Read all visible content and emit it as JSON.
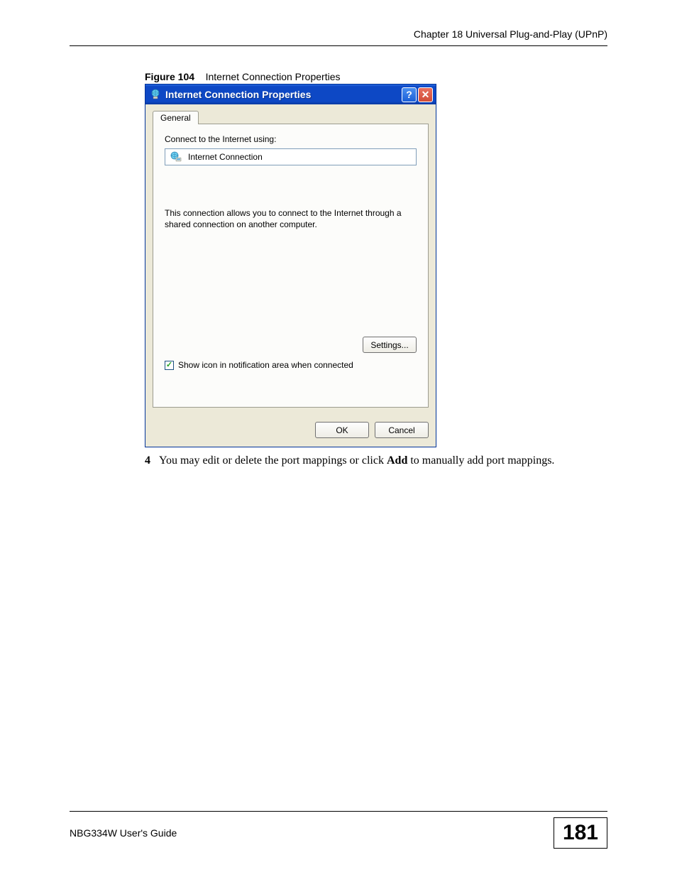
{
  "header": {
    "chapter": "Chapter 18 Universal Plug-and-Play (UPnP)"
  },
  "figure": {
    "label": "Figure 104",
    "caption": "Internet Connection Properties"
  },
  "dialog": {
    "title": "Internet Connection Properties",
    "help": "?",
    "close": "✕",
    "tab": "General",
    "connect_label": "Connect to the Internet using:",
    "connection_name": "Internet Connection",
    "description": "This connection allows you to connect to the Internet through a shared connection on another computer.",
    "settings_btn": "Settings...",
    "checkbox_label": "Show icon in notification area when connected",
    "checkbox_mark": "✓",
    "ok": "OK",
    "cancel": "Cancel"
  },
  "instruction": {
    "step": "4",
    "text_before": "You may edit or delete the port mappings or click ",
    "bold": "Add",
    "text_after": " to manually add port mappings."
  },
  "footer": {
    "guide": "NBG334W User's Guide",
    "page": "181"
  }
}
